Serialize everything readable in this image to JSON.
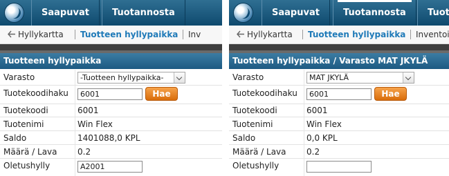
{
  "left": {
    "nav": [
      "Saapuvat",
      "Tuotannosta"
    ],
    "crumbs": [
      "Hyllykartta",
      "Tuotteen hyllypaikka",
      "Inv"
    ],
    "title": "Tuotteen hyllypaikka",
    "labels": {
      "varasto": "Varasto",
      "tuotekoodihaku": "Tuotekoodihaku",
      "tuotekoodi": "Tuotekoodi",
      "tuotenimi": "Tuotenimi",
      "saldo": "Saldo",
      "maara_lava": "Määrä / Lava",
      "oletushylly": "Oletushylly"
    },
    "varasto_select": "-Tuotteen hyllypaikka-",
    "search_value": "6001",
    "search_button": "Hae",
    "tuotekoodi": "6001",
    "tuotenimi": "Win Flex",
    "saldo": "1401088,0 KPL",
    "maara_lava": "0.2",
    "oletushylly": "A2001"
  },
  "right": {
    "nav": [
      "Saapuvat",
      "Tuotannosta",
      "Tuota"
    ],
    "crumbs": [
      "Hyllykartta",
      "Tuotteen hyllypaikka",
      "Inventoi"
    ],
    "title": "Tuotteen hyllypaikka / Varasto MAT JKYLÄ",
    "labels": {
      "varasto": "Varasto",
      "tuotekoodihaku": "Tuotekoodihaku",
      "tuotekoodi": "Tuotekoodi",
      "tuotenimi": "Tuotenimi",
      "saldo": "Saldo",
      "maara_lava": "Määrä / Lava",
      "oletushylly": "Oletushylly"
    },
    "varasto_select": "MAT JKYLÄ",
    "search_value": "6001",
    "search_button": "Hae",
    "tuotekoodi": "6001",
    "tuotenimi": "Win Flex",
    "saldo": "0,0 KPL",
    "maara_lava": "0.2",
    "oletushylly": ""
  },
  "colors": {
    "topbar": "#1d5a82",
    "accent_link": "#1f7ab8",
    "button": "#e7831f"
  },
  "icons": [
    "logo-globe-icon",
    "back-arrow-icon",
    "chevron-down-icon"
  ]
}
